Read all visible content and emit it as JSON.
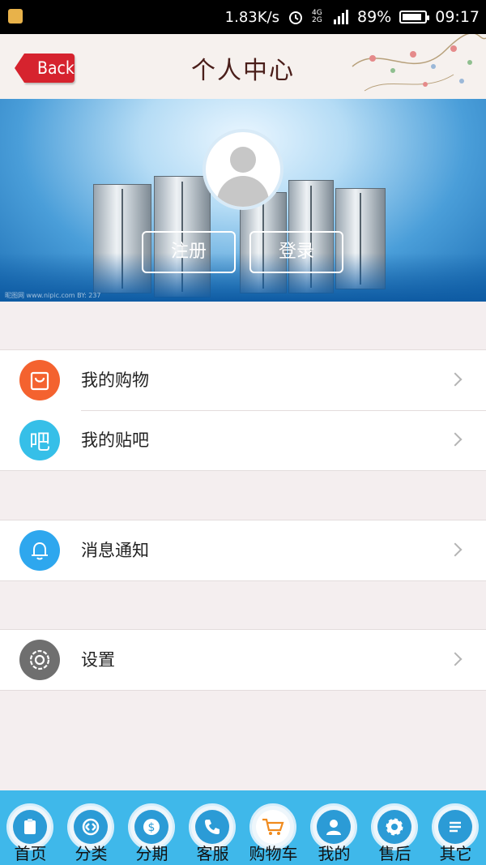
{
  "status_bar": {
    "net_speed": "1.83K/s",
    "net_type": "4G 2G",
    "battery": "89%",
    "battery_level": 0.89,
    "time": "09:17"
  },
  "header": {
    "back_label": "Back",
    "title": "个人中心",
    "back_color": "#d6232e"
  },
  "banner": {
    "register_label": "注册",
    "login_label": "登录",
    "watermark": "昵图网 www.nipic.com   BY: 237"
  },
  "menu": {
    "groups": [
      {
        "items": [
          {
            "label": "我的购物",
            "icon": "shopping-bag-icon",
            "color": "#f4622f"
          },
          {
            "label": "我的贴吧",
            "icon": "bar-icon",
            "color": "#36bfe8",
            "glyph": "吧"
          }
        ]
      },
      {
        "items": [
          {
            "label": "消息通知",
            "icon": "bell-icon",
            "color": "#2ea7ee"
          }
        ]
      },
      {
        "items": [
          {
            "label": "设置",
            "icon": "gear-icon",
            "color": "#6f6f6f"
          }
        ]
      }
    ]
  },
  "bottom_nav": {
    "items": [
      {
        "label": "首页",
        "icon": "clipboard-icon"
      },
      {
        "label": "分类",
        "icon": "swap-icon"
      },
      {
        "label": "分期",
        "icon": "dollar-icon"
      },
      {
        "label": "客服",
        "icon": "phone-icon"
      },
      {
        "label": "购物车",
        "icon": "cart-icon",
        "active": true
      },
      {
        "label": "我的",
        "icon": "user-icon"
      },
      {
        "label": "售后",
        "icon": "gear-icon"
      },
      {
        "label": "其它",
        "icon": "list-icon"
      }
    ],
    "background": "#3fb8ea"
  }
}
